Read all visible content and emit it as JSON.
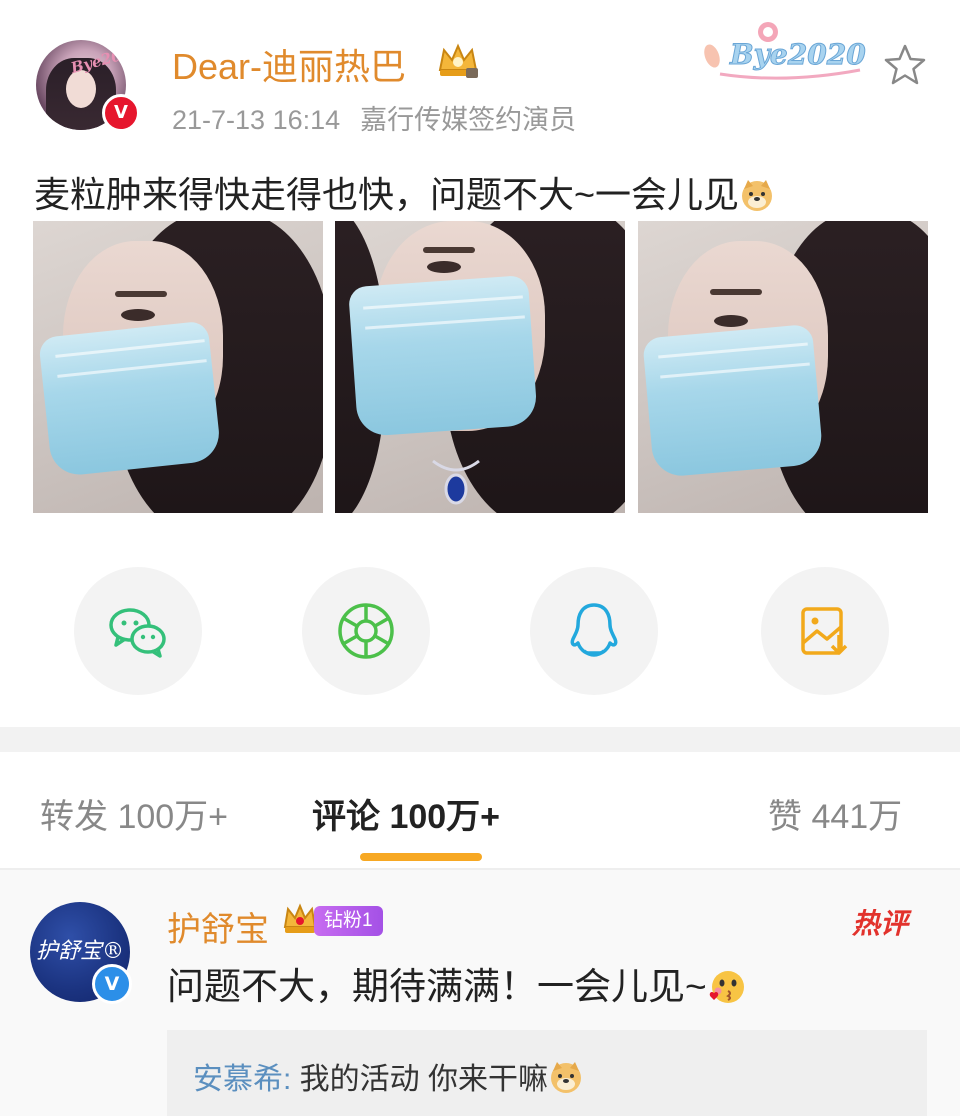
{
  "post": {
    "username": "Dear-迪丽热巴",
    "timestamp": "21-7-13 16:14",
    "source": "嘉行传媒签约演员",
    "text": "麦粒肿来得快走得也快，问题不大~一会儿见",
    "avatar_sticker": "Bye2020",
    "header_sticker": "Bye2020",
    "verified_badge": "V",
    "photos_count": 3
  },
  "share": {
    "items": [
      {
        "icon": "wechat-icon",
        "color": "#34c07a"
      },
      {
        "icon": "moments-icon",
        "color": "#4cc04a"
      },
      {
        "icon": "qq-icon",
        "color": "#22a8dd"
      },
      {
        "icon": "save-image-icon",
        "color": "#f2a91b"
      }
    ]
  },
  "tabs": {
    "repost_label": "转发",
    "repost_count": "100万+",
    "comment_label": "评论",
    "comment_count": "100万+",
    "like_label": "赞",
    "like_count": "441万",
    "active": "comment",
    "accent": "#f7a823"
  },
  "comment": {
    "username": "护舒宝",
    "avatar_text": "护舒宝®",
    "fan_badge": "钻粉1",
    "hot_label": "热评",
    "text": "问题不大，期待满满！一会儿见~",
    "verified_badge": "V",
    "reply": {
      "user": "安慕希",
      "separator": ": ",
      "text": "我的活动 你来干嘛"
    }
  }
}
